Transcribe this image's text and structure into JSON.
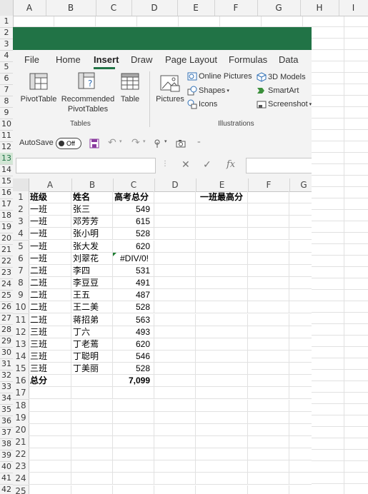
{
  "outer_sheet": {
    "columns": [
      "A",
      "B",
      "C",
      "D",
      "E",
      "F",
      "G",
      "H",
      "I"
    ],
    "rows": [
      "1",
      "2",
      "3",
      "4",
      "5",
      "6",
      "7",
      "8",
      "9",
      "10",
      "11",
      "12",
      "13",
      "14",
      "15",
      "16",
      "17",
      "18",
      "19",
      "20",
      "21",
      "22",
      "23",
      "24",
      "25",
      "26",
      "27",
      "28",
      "29",
      "30",
      "31",
      "32",
      "33",
      "34",
      "35",
      "36",
      "37",
      "38",
      "39",
      "40",
      "41",
      "42"
    ]
  },
  "ribbon": {
    "tabs": [
      "File",
      "Home",
      "Insert",
      "Draw",
      "Page Layout",
      "Formulas",
      "Data"
    ],
    "active_tab": "Insert",
    "tables_group": {
      "label": "Tables",
      "pivot_table": "PivotTable",
      "recommended_line1": "Recommended",
      "recommended_line2": "PivotTables",
      "table": "Table"
    },
    "illustrations_group": {
      "label": "Illustrations",
      "pictures": "Pictures",
      "online_pictures": "Online Pictures",
      "shapes": "Shapes",
      "icons": "Icons",
      "models_3d": "3D Models",
      "smartart": "SmartArt",
      "screenshot": "Screenshot"
    }
  },
  "qat": {
    "autosave_label": "AutoSave",
    "autosave_state": "Off"
  },
  "formula_bar": {
    "fx": "fx",
    "cancel": "✕",
    "confirm": "✓"
  },
  "sheet": {
    "columns": [
      "A",
      "B",
      "C",
      "D",
      "E",
      "F",
      "G"
    ],
    "rows": [
      {
        "n": "1",
        "a": "班级",
        "b": "姓名",
        "c": "高考总分",
        "e": "一班最高分"
      },
      {
        "n": "2",
        "a": "一班",
        "b": "张三",
        "c": "549"
      },
      {
        "n": "3",
        "a": "一班",
        "b": "邓芳芳",
        "c": "615"
      },
      {
        "n": "4",
        "a": "一班",
        "b": "张小明",
        "c": "528"
      },
      {
        "n": "5",
        "a": "一班",
        "b": "张大发",
        "c": "620"
      },
      {
        "n": "6",
        "a": "一班",
        "b": "刘翠花",
        "c": "#DIV/0!"
      },
      {
        "n": "7",
        "a": "二班",
        "b": "李四",
        "c": "531"
      },
      {
        "n": "8",
        "a": "二班",
        "b": "李豆豆",
        "c": "491"
      },
      {
        "n": "9",
        "a": "二班",
        "b": "王五",
        "c": "487"
      },
      {
        "n": "10",
        "a": "二班",
        "b": "王二美",
        "c": "528"
      },
      {
        "n": "11",
        "a": "二班",
        "b": "蒋招弟",
        "c": "563"
      },
      {
        "n": "12",
        "a": "三班",
        "b": "丁六",
        "c": "493"
      },
      {
        "n": "13",
        "a": "三班",
        "b": "丁老蔫",
        "c": "620"
      },
      {
        "n": "14",
        "a": "三班",
        "b": "丁聪明",
        "c": "546"
      },
      {
        "n": "15",
        "a": "三班",
        "b": "丁美丽",
        "c": "528"
      },
      {
        "n": "16",
        "a": "总分",
        "b": "",
        "c": "7,099"
      },
      {
        "n": "17"
      },
      {
        "n": "18"
      },
      {
        "n": "19"
      },
      {
        "n": "20"
      },
      {
        "n": "21"
      },
      {
        "n": "22"
      },
      {
        "n": "23"
      },
      {
        "n": "24"
      },
      {
        "n": "25"
      }
    ]
  },
  "colors": {
    "excel_green": "#217346",
    "ribbon_bg": "#f3f3f3",
    "error_triangle": "#1e7d32"
  }
}
